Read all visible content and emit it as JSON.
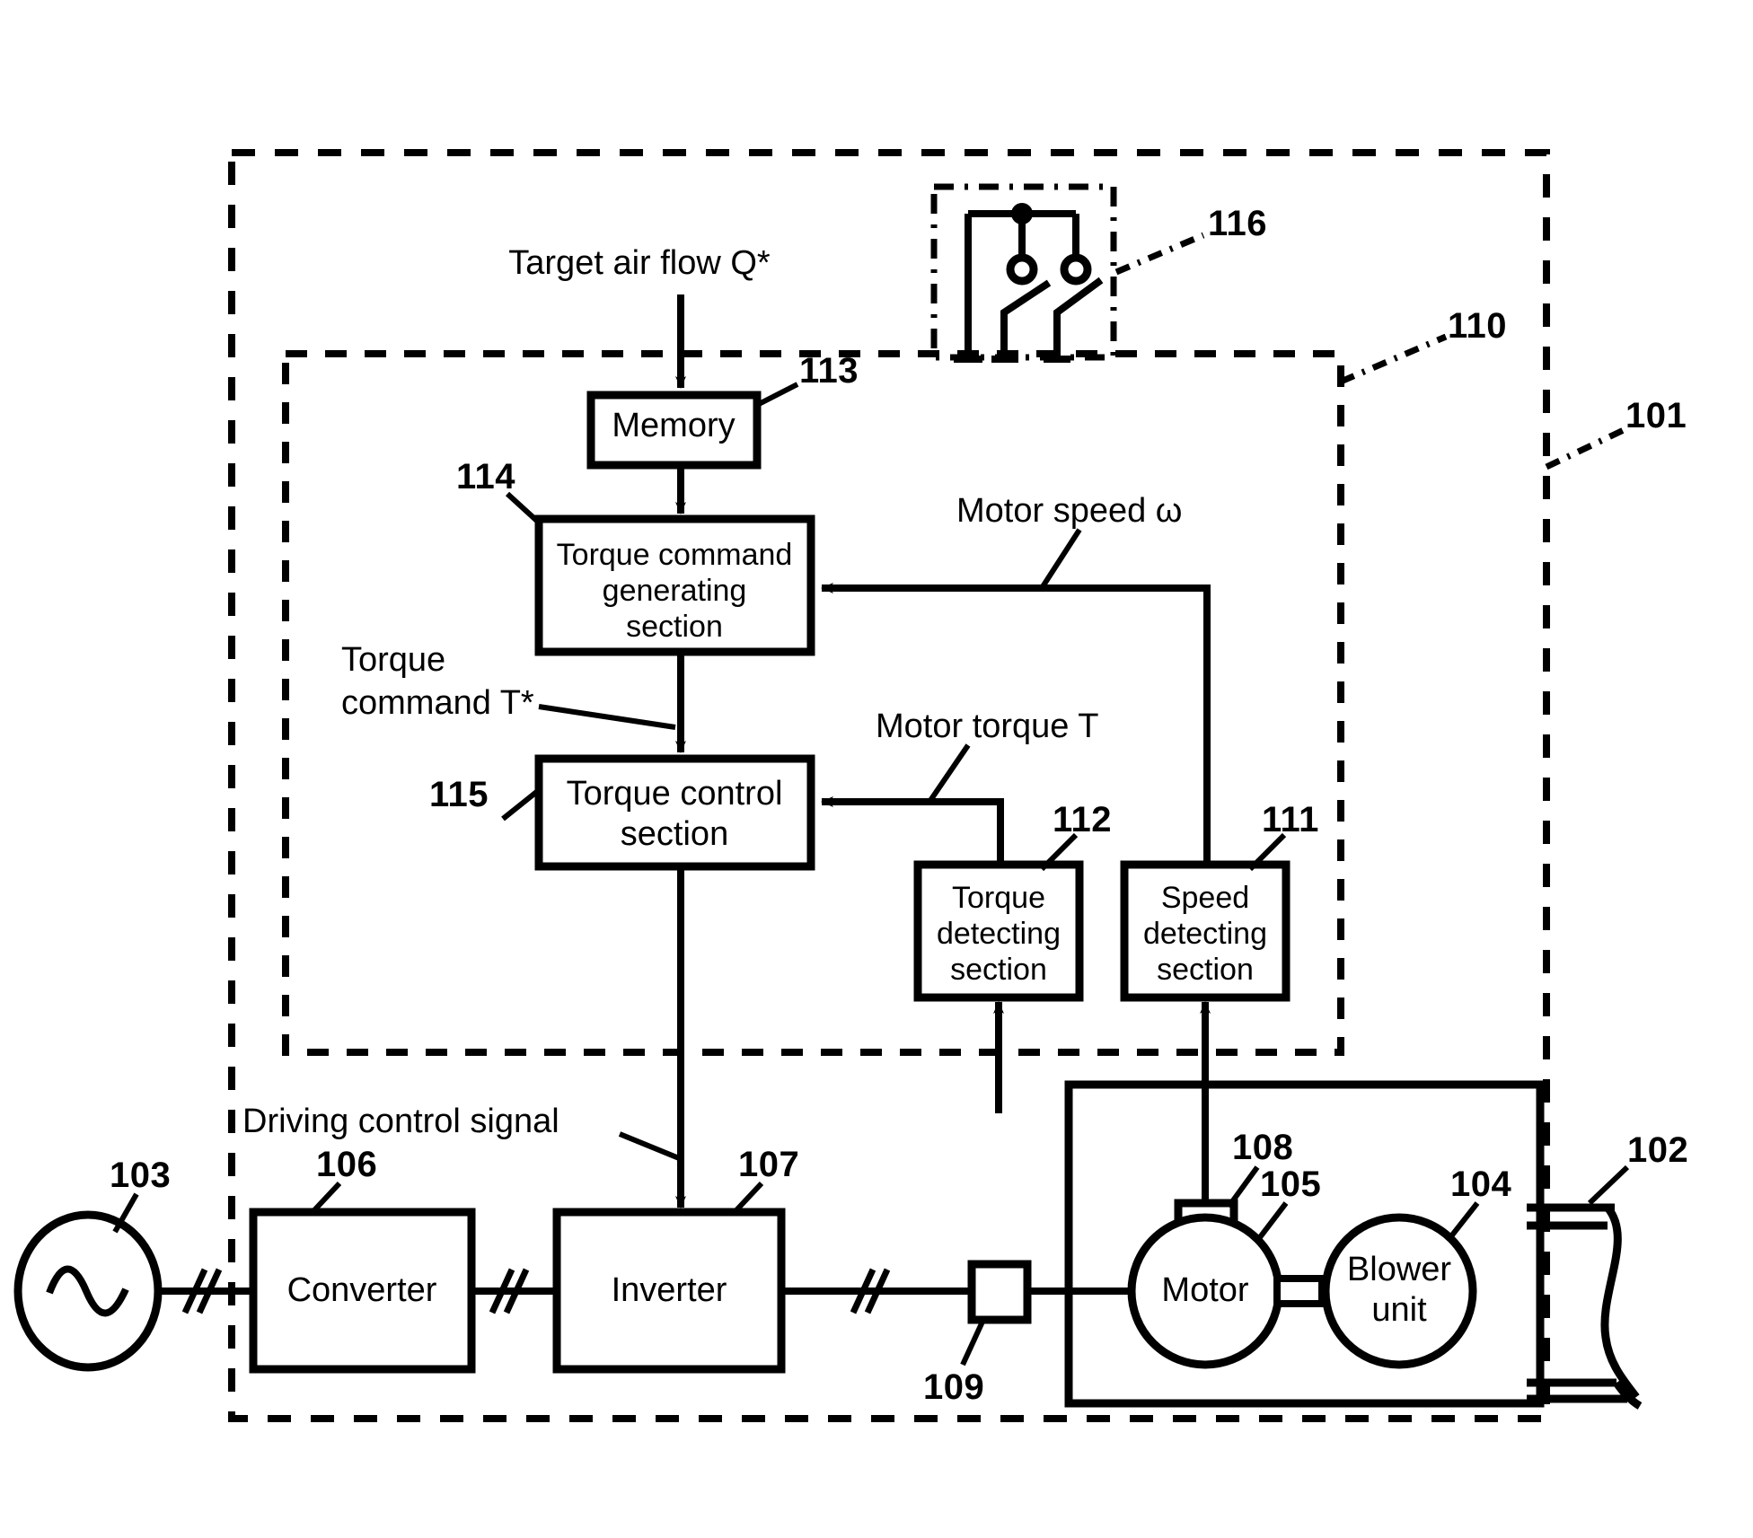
{
  "figure": {
    "kind": "patent-block-diagram",
    "line_color": "#000000",
    "background": "#ffffff"
  },
  "signals": {
    "target_air_flow": "Target air flow Q*",
    "torque_command": "Torque command T*",
    "torque_command_line1": "Torque",
    "torque_command_line2": "command T*",
    "motor_speed": "Motor speed ω",
    "motor_torque": "Motor torque T",
    "driving_control_signal": "Driving control signal"
  },
  "blocks": {
    "memory": {
      "label": "Memory",
      "ref": "113"
    },
    "torque_command_generating": {
      "line1": "Torque command",
      "line2": "generating",
      "line3": "section",
      "ref": "114"
    },
    "torque_control": {
      "line1": "Torque control",
      "line2": "section",
      "ref": "115"
    },
    "torque_detecting": {
      "line1": "Torque",
      "line2": "detecting",
      "line3": "section",
      "ref": "112"
    },
    "speed_detecting": {
      "line1": "Speed",
      "line2": "detecting",
      "line3": "section",
      "ref": "111"
    },
    "converter": {
      "label": "Converter",
      "ref": "106"
    },
    "inverter": {
      "label": "Inverter",
      "ref": "107"
    },
    "motor": {
      "label": "Motor",
      "ref": "105"
    },
    "blower_unit": {
      "line1": "Blower",
      "line2": "unit",
      "ref": "104"
    }
  },
  "components": {
    "ac_source": {
      "ref": "103",
      "symbol": "sine-wave"
    },
    "speed_sensor": {
      "ref": "108"
    },
    "current_sensor": {
      "ref": "109"
    },
    "selector_switch": {
      "ref": "116"
    },
    "duct": {
      "ref": "102"
    }
  },
  "enclosures": {
    "outer_apparatus": {
      "ref": "101",
      "style": "dashed"
    },
    "control_unit": {
      "ref": "110",
      "style": "dashed"
    },
    "switch_box": {
      "ref": "116",
      "style": "dash-dot"
    }
  },
  "ref_numbers": [
    "101",
    "102",
    "103",
    "104",
    "105",
    "106",
    "107",
    "108",
    "109",
    "110",
    "111",
    "112",
    "113",
    "114",
    "115",
    "116"
  ]
}
